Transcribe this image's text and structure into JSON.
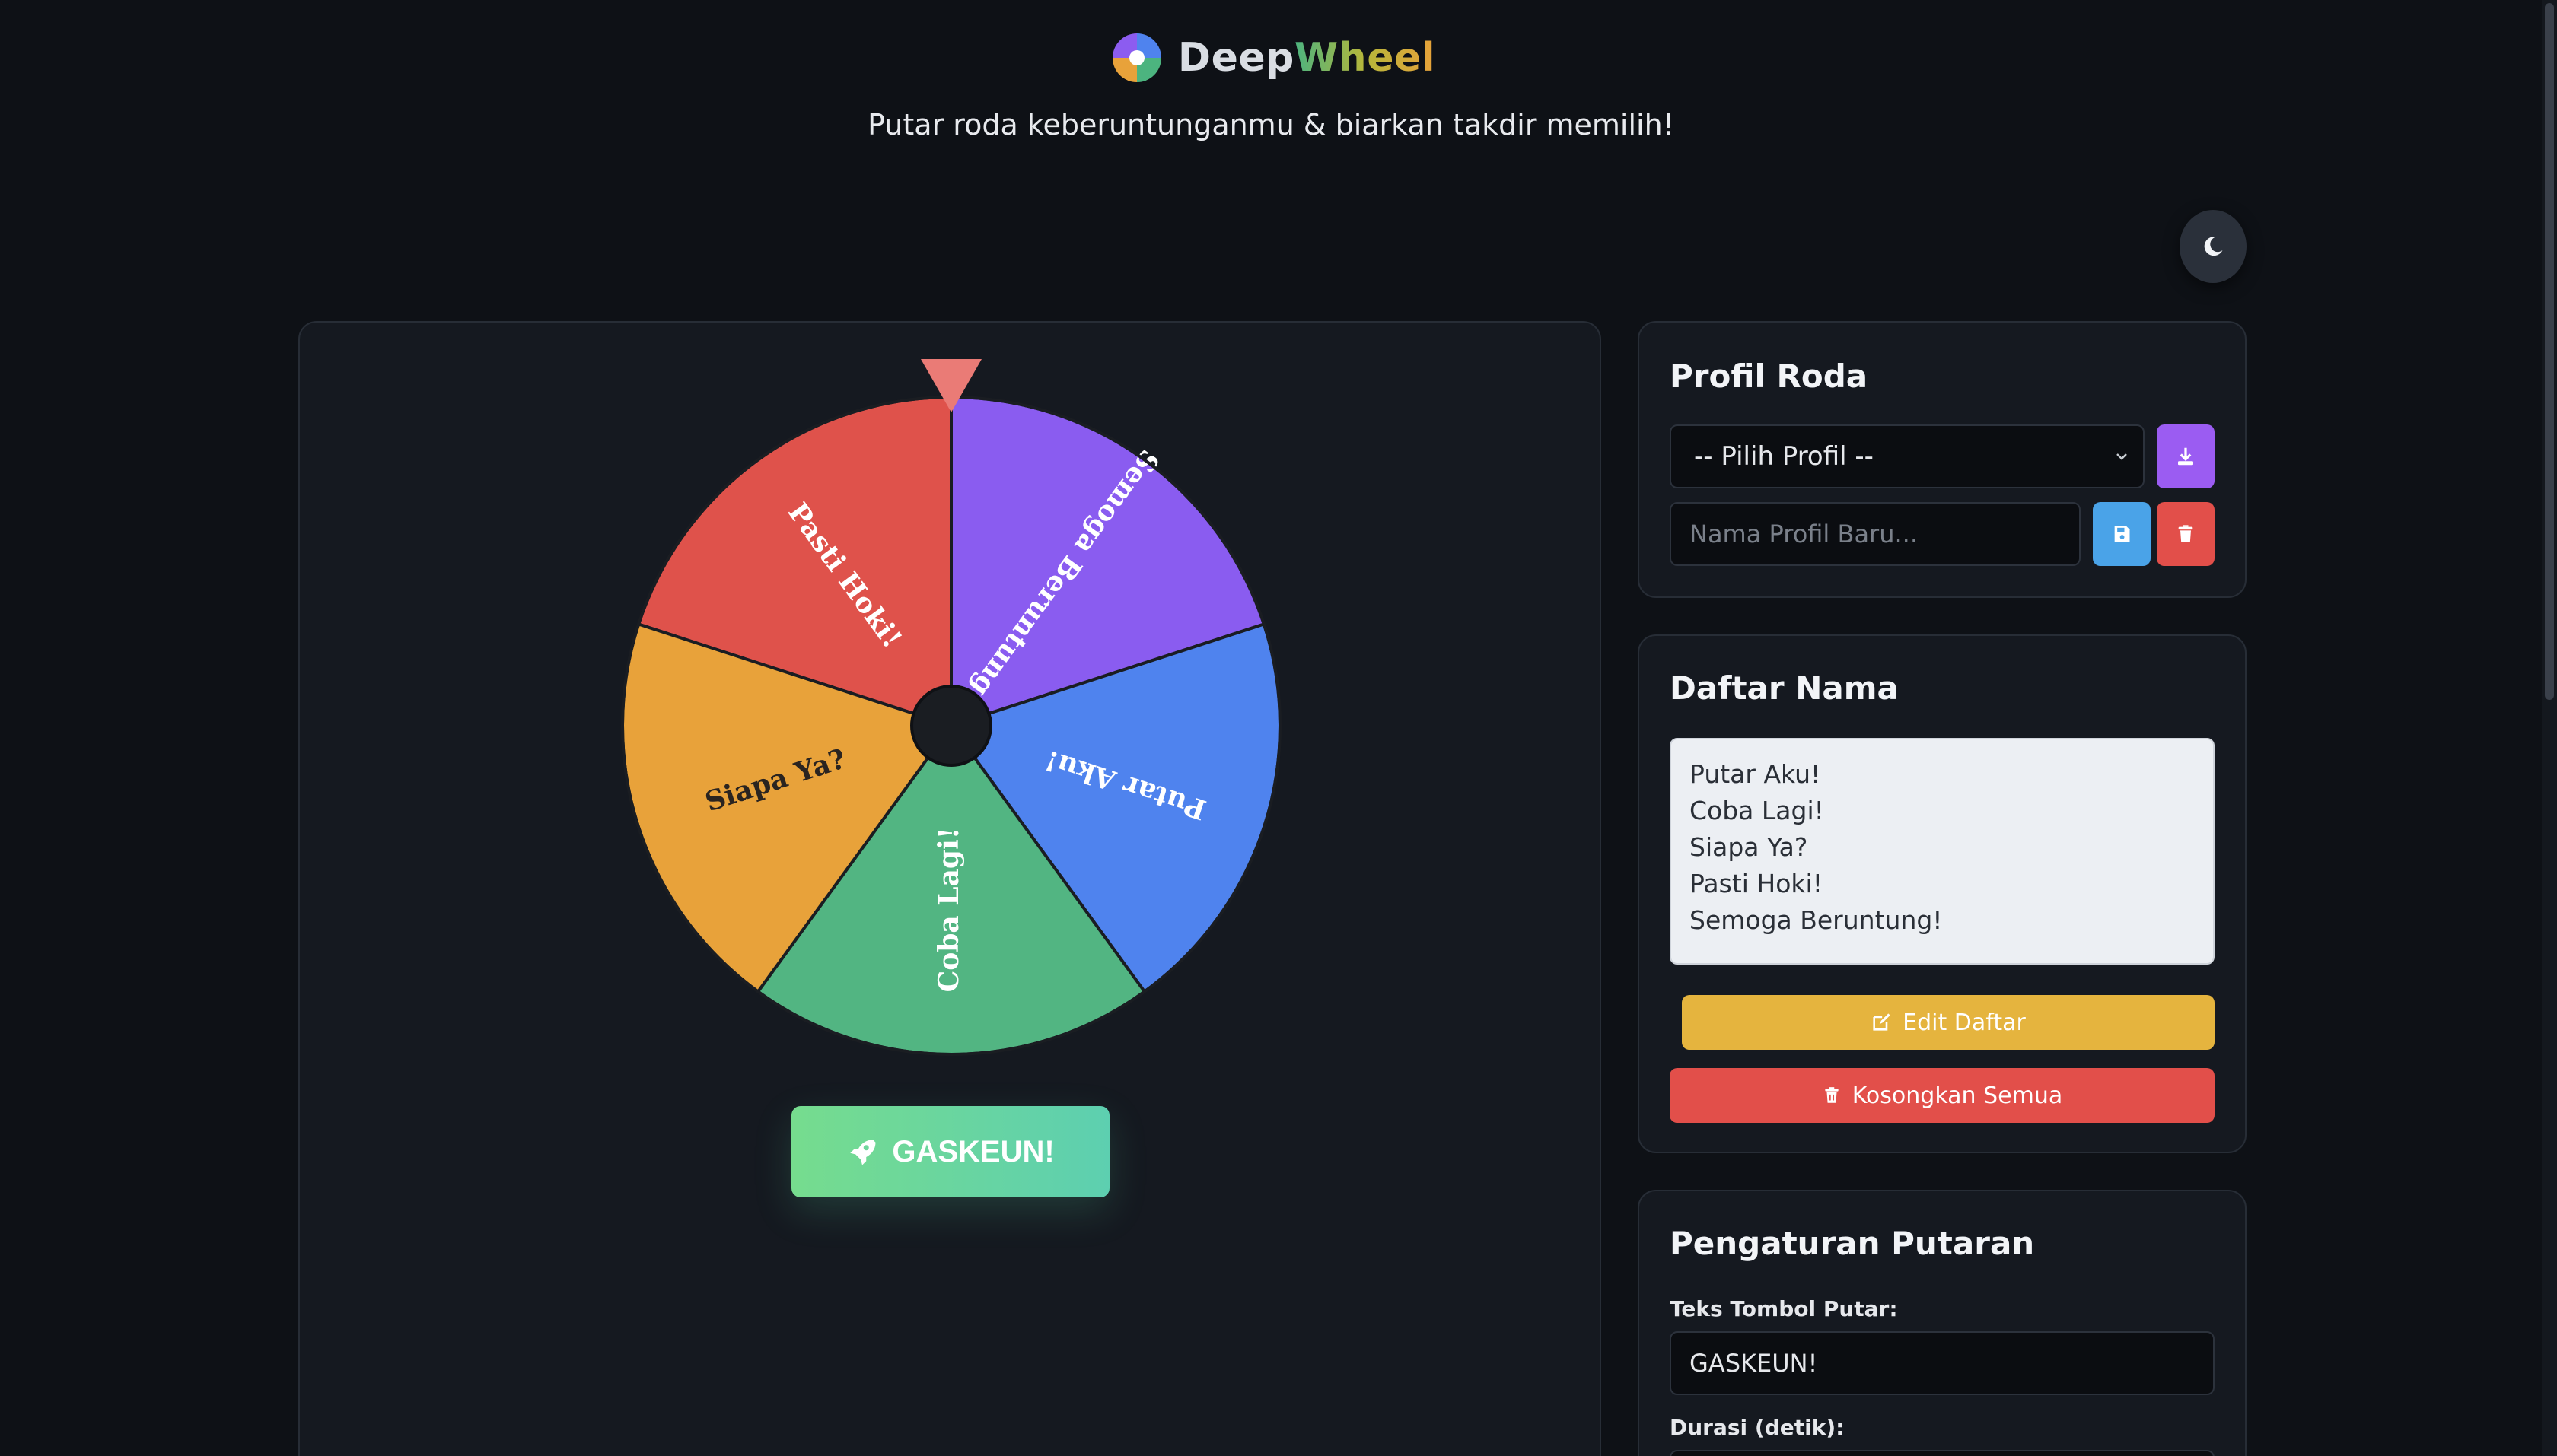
{
  "app": {
    "brand_part1": "Deep",
    "brand_part2": "Wheel",
    "tagline": "Putar roda keberuntunganmu & biarkan takdir memilih!"
  },
  "wheel": {
    "segments": [
      {
        "label": "Pasti Hoki!",
        "color": "#df524b"
      },
      {
        "label": "Semoga Beruntung!",
        "color": "#8a5cf0"
      },
      {
        "label": "Putar Aku!",
        "color": "#4f83ee"
      },
      {
        "label": "Coba Lagi!",
        "color": "#52b582"
      },
      {
        "label": "Siapa Ya?",
        "color": "#e8a23a"
      }
    ],
    "pointer_color": "#ea7b76",
    "spin_button": "GASKEUN!"
  },
  "profile_card": {
    "title": "Profil Roda",
    "select_value": "-- Pilih Profil --",
    "new_profile_placeholder": "Nama Profil Baru..."
  },
  "names_card": {
    "title": "Daftar Nama",
    "names": [
      "Putar Aku!",
      "Coba Lagi!",
      "Siapa Ya?",
      "Pasti Hoki!",
      "Semoga Beruntung!"
    ],
    "edit_button": "Edit Daftar",
    "clear_button": "Kosongkan Semua"
  },
  "spin_settings": {
    "title": "Pengaturan Putaran",
    "button_text_label": "Teks Tombol Putar:",
    "button_text_value": "GASKEUN!",
    "duration_label": "Durasi (detik):"
  },
  "colors": {
    "accent_purple": "#9b5cf2",
    "accent_blue": "#4aa3e8",
    "accent_red": "#e24f4a",
    "accent_yellow": "#e5b43e"
  }
}
